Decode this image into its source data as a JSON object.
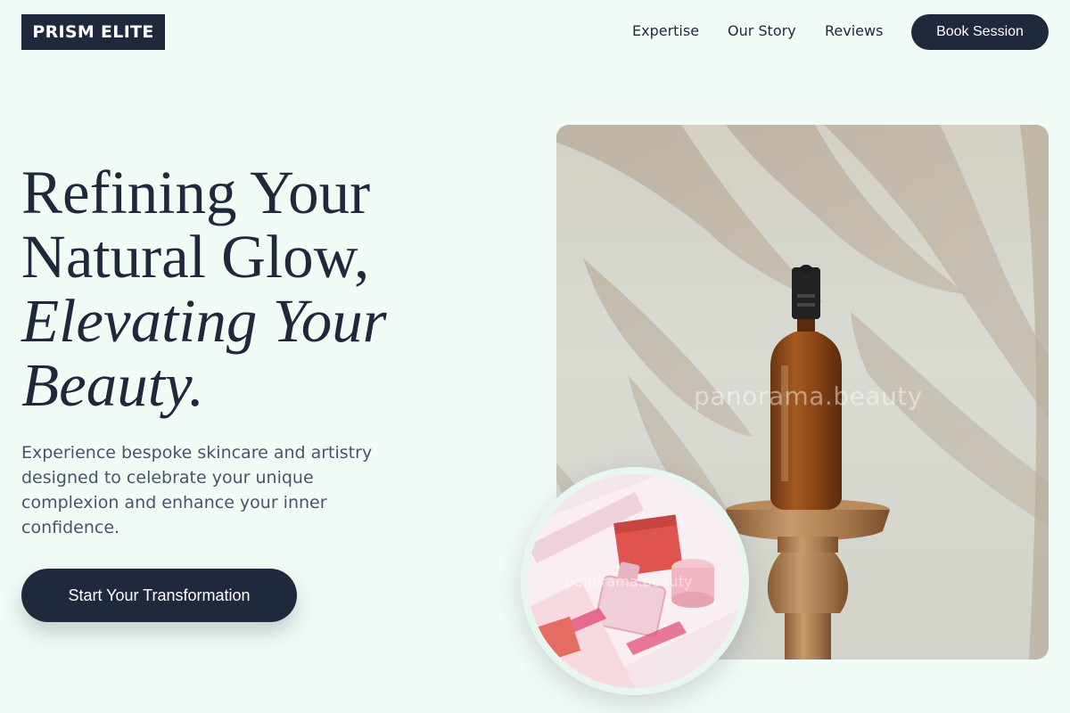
{
  "brand": {
    "name": "PRISM ELITE"
  },
  "nav": {
    "links": [
      "Expertise",
      "Our Story",
      "Reviews"
    ],
    "cta_label": "Book Session"
  },
  "hero": {
    "headline_lines": [
      "Refining Your",
      "Natural Glow,"
    ],
    "headline_italic_lines": [
      "Elevating Your",
      "Beauty."
    ],
    "subtext": "Experience bespoke skincare and artistry designed to celebrate your unique complexion and enhance your inner confidence.",
    "cta_label": "Start Your Transformation"
  },
  "images": {
    "main_watermark": "panorama.beauty",
    "secondary_watermark": "panorama.beauty",
    "main_image": "serum-bottle-on-wooden-stand-with-palm-shadows",
    "secondary_image": "pink-skincare-gift-box"
  },
  "colors": {
    "background": "#f2fcf7",
    "primary": "#1e293b",
    "text_muted": "#475569"
  }
}
